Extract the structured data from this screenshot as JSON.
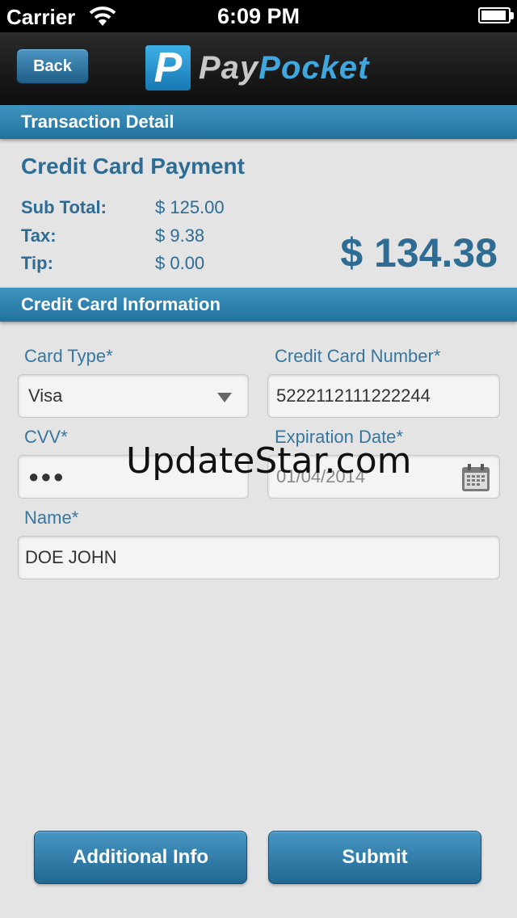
{
  "status_bar": {
    "carrier": "Carrier",
    "time": "6:09 PM"
  },
  "nav": {
    "back_label": "Back",
    "logo_letter": "P",
    "logo_part1": "Pay",
    "logo_part2": "Pocket"
  },
  "transaction": {
    "header": "Transaction Detail",
    "title": "Credit Card Payment",
    "rows": [
      {
        "label": "Sub Total:",
        "value": "$ 125.00"
      },
      {
        "label": "Tax:",
        "value": "$ 9.38"
      },
      {
        "label": "Tip:",
        "value": "$ 0.00"
      }
    ],
    "total": "$ 134.38"
  },
  "card": {
    "header": "Credit Card Information",
    "card_type_label": "Card Type*",
    "card_type_value": "Visa",
    "number_label": "Credit Card Number*",
    "number_value": "5222112111222244",
    "cvv_label": "CVV*",
    "cvv_value": "●●●",
    "expiration_label": "Expiration Date*",
    "expiration_value": "01/04/2014",
    "name_label": "Name*",
    "name_value": "DOE JOHN"
  },
  "watermark": "UpdateStar.com",
  "buttons": {
    "additional_info": "Additional Info",
    "submit": "Submit"
  },
  "colors": {
    "accent": "#2e6c94",
    "header": "#2f86b3",
    "background": "#e4e4e4"
  },
  "icons": [
    "wifi-icon",
    "battery-icon",
    "chevron-down-icon",
    "calendar-icon"
  ]
}
